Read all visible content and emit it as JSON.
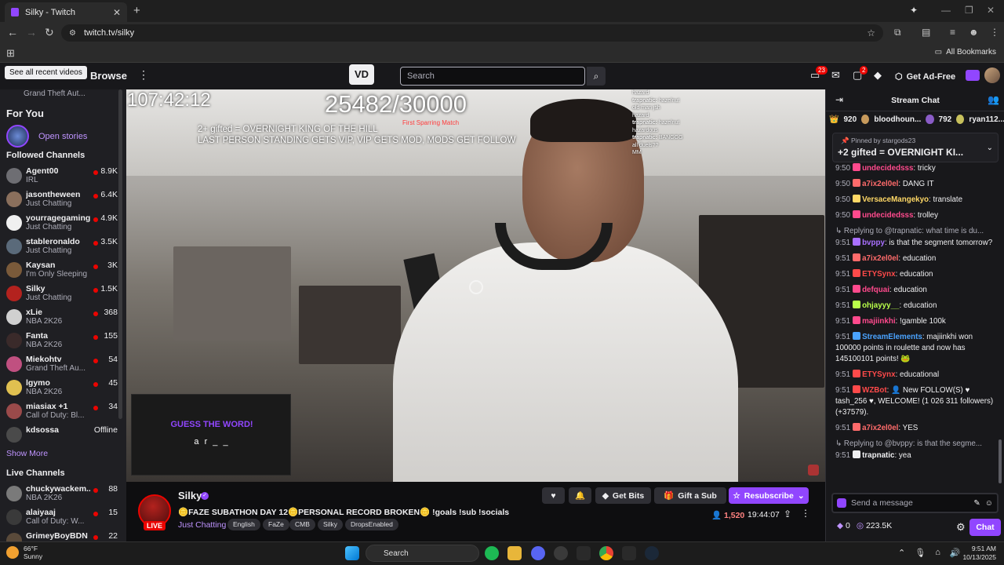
{
  "browser": {
    "tab_title": "Silky - Twitch",
    "url": "twitch.tv/silky",
    "all_bookmarks": "All Bookmarks"
  },
  "topnav": {
    "tooltip": "See all recent videos",
    "browse": "Browse",
    "search_placeholder": "Search",
    "inbox_badge": "23",
    "whispers_badge": "2",
    "get_ad_free": "Get Ad-Free"
  },
  "sidebar": {
    "top_game": "Grand Theft Aut...",
    "for_you": "For You",
    "open_stories": "Open stories",
    "followed_title": "Followed Channels",
    "followed": [
      {
        "name": "Agent00",
        "game": "IRL",
        "viewers": "8.9K",
        "color": "#6e6e73",
        "live": true
      },
      {
        "name": "jasontheween",
        "game": "Just Chatting",
        "viewers": "6.4K",
        "color": "#8a6f5c",
        "live": true
      },
      {
        "name": "yourragegaming",
        "game": "Just Chatting",
        "viewers": "4.9K",
        "color": "#f0f0f0",
        "live": true
      },
      {
        "name": "stableronaldo",
        "game": "Just Chatting",
        "viewers": "3.5K",
        "color": "#5a6a7a",
        "live": true
      },
      {
        "name": "Kaysan",
        "game": "I'm Only Sleeping",
        "viewers": "3K",
        "color": "#7a5a3a",
        "live": true
      },
      {
        "name": "Silky",
        "game": "Just Chatting",
        "viewers": "1.5K",
        "color": "#b3221e",
        "live": true
      },
      {
        "name": "xLie",
        "game": "NBA 2K26",
        "viewers": "368",
        "color": "#d0d0d0",
        "live": true
      },
      {
        "name": "Fanta",
        "game": "NBA 2K26",
        "viewers": "155",
        "color": "#3a2a2a",
        "live": true
      },
      {
        "name": "Miekohtv",
        "game": "Grand Theft Au...",
        "viewers": "54",
        "color": "#c05080",
        "live": true
      },
      {
        "name": "lgymo",
        "game": "NBA 2K26",
        "viewers": "45",
        "color": "#e0c050",
        "live": true
      },
      {
        "name": "miasiax +1",
        "game": "Call of Duty: Bl...",
        "viewers": "34",
        "color": "#9a4a4a",
        "live": true
      },
      {
        "name": "kdsossa",
        "game": "",
        "viewers": "Offline",
        "color": "#4a4a4a",
        "live": false
      }
    ],
    "show_more": "Show More",
    "live_title": "Live Channels",
    "live": [
      {
        "name": "chuckywackem...",
        "game": "NBA 2K26",
        "viewers": "88",
        "color": "#7a7a7a",
        "live": true
      },
      {
        "name": "alaiyaaj",
        "game": "Call of Duty: W...",
        "viewers": "15",
        "color": "#3a3a3a",
        "live": true
      },
      {
        "name": "GrimeyBoyBDN",
        "game": "",
        "viewers": "22",
        "color": "#5a4a3a",
        "live": true
      }
    ]
  },
  "video": {
    "timer": "107:42:12",
    "sub_count": "25482/30000",
    "sub_label": "First Sparring Match",
    "rules": "2+ gifted = OVERNIGHT KING OF THE HILL\nLAST PERSON STANDING GETS VIP, VIP GETS MOD, MODS GET FOLLOW",
    "guess_title": "GUESS THE WORD!",
    "guess_word": "a r _ _",
    "overlay_chat": [
      {
        "u": "",
        "t": "hazard"
      },
      {
        "u": "trapnatic",
        "t": "hazelnut"
      },
      {
        "u": "",
        "t": "old man jsh"
      },
      {
        "u": "",
        "t": "hazard"
      },
      {
        "u": "trapnatic",
        "t": "hazelnut"
      },
      {
        "u": "",
        "t": "hazardous"
      },
      {
        "u": "trapnatic",
        "t": "BANGGG"
      },
      {
        "u": "",
        "t": "all duels??"
      },
      {
        "u": "",
        "t": "MM"
      }
    ]
  },
  "stream": {
    "name": "Silky",
    "live": "LIVE",
    "title": "🪙FAZE SUBATHON DAY 12🪙PERSONAL RECORD BROKEN🪙 !goals !sub !socials",
    "category": "Just Chatting",
    "tags": [
      "English",
      "FaZe",
      "CMB",
      "Silky",
      "DropsEnabled"
    ],
    "get_bits": "Get Bits",
    "gift_sub": "Gift a Sub",
    "resubscribe": "Resubscribe",
    "viewers": "1,520",
    "uptime": "19:44:07"
  },
  "chat": {
    "title": "Stream Chat",
    "leaderboard": [
      {
        "rank": "👑",
        "amount": "920",
        "name": "bloodhoun..."
      },
      {
        "rank": "",
        "amount": "792",
        "name": "ryan112..."
      }
    ],
    "pinned_by": "Pinned by",
    "pinned_user": "stargods23",
    "pinned_msg": "+2 gifted = OVERNIGHT KI...",
    "messages": [
      {
        "ts": "9:50",
        "user": "undecidedsss",
        "color": "#ff4a8d",
        "text": "tricky",
        "reply": ""
      },
      {
        "ts": "9:50",
        "user": "a7ix2el0el",
        "color": "#ff6b6b",
        "text": "DANG IT",
        "reply": ""
      },
      {
        "ts": "9:50",
        "user": "VersaceMangekyo",
        "color": "#ffd866",
        "text": "translate",
        "reply": ""
      },
      {
        "ts": "9:50",
        "user": "undecidedsss",
        "color": "#ff4a8d",
        "text": "trolley",
        "reply": ""
      },
      {
        "ts": "9:51",
        "user": "bvppy",
        "color": "#a970ff",
        "text": "is that the segment tomorrow?",
        "reply": "Replying to @trapnatic: what time is du..."
      },
      {
        "ts": "9:51",
        "user": "a7ix2el0el",
        "color": "#ff6b6b",
        "text": "education",
        "reply": ""
      },
      {
        "ts": "9:51",
        "user": "ETYSynx",
        "color": "#ff4a4a",
        "text": "education",
        "reply": ""
      },
      {
        "ts": "9:51",
        "user": "defquai",
        "color": "#ff4a8d",
        "text": "education",
        "reply": ""
      },
      {
        "ts": "9:51",
        "user": "ohjayyy__",
        "color": "#b9ff4a",
        "text": "education",
        "reply": ""
      },
      {
        "ts": "9:51",
        "user": "majiinkhi",
        "color": "#ff4a8d",
        "text": "!gamble 100k",
        "reply": ""
      },
      {
        "ts": "9:51",
        "user": "StreamElements",
        "color": "#4aa3ff",
        "text": "majiinkhi won 100000 points in roulette and now has 145100101 points! 🐸",
        "reply": ""
      },
      {
        "ts": "9:51",
        "user": "ETYSynx",
        "color": "#ff4a4a",
        "text": "educational",
        "reply": ""
      },
      {
        "ts": "9:51",
        "user": "WZBot",
        "color": "#ff4a4a",
        "text": "👤 New FOLLOW(S) ♥ tash_256 ♥, WELCOME! (1 026 311 followers) (+37579).",
        "reply": ""
      },
      {
        "ts": "9:51",
        "user": "a7ix2el0el",
        "color": "#ff6b6b",
        "text": "YES",
        "reply": ""
      },
      {
        "ts": "9:51",
        "user": "trapnatic",
        "color": "#efeff1",
        "text": "yea",
        "reply": "Replying to @bvppy: is that the segme..."
      }
    ],
    "placeholder": "Send a message",
    "bits": "0",
    "channel_points": "223.5K",
    "chat_btn": "Chat"
  },
  "taskbar": {
    "temp": "66°F",
    "cond": "Sunny",
    "search": "Search",
    "time": "9:51 AM",
    "date": "10/13/2025"
  }
}
